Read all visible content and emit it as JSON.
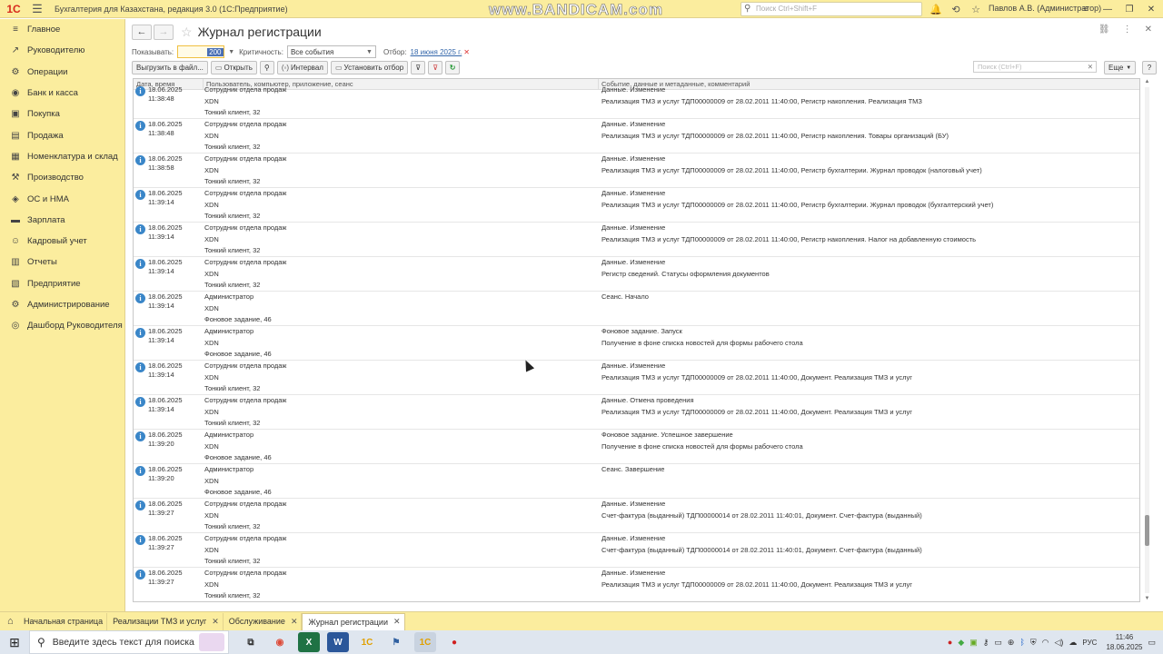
{
  "titlebar": {
    "logo": "1С",
    "app_title": "Бухгалтерия для Казахстана, редакция 3.0 (1С:Предприятие)",
    "watermark": "www.BANDICAM.com",
    "search_placeholder": "Поиск Ctrl+Shift+F",
    "user": "Павлов А.В. (Администратор)"
  },
  "sidebar": {
    "items": [
      {
        "label": "Главное",
        "icon": "menu-icon"
      },
      {
        "label": "Руководителю",
        "icon": "chart-line-icon"
      },
      {
        "label": "Операции",
        "icon": "operations-icon"
      },
      {
        "label": "Банк и касса",
        "icon": "bank-icon"
      },
      {
        "label": "Покупка",
        "icon": "cart-icon"
      },
      {
        "label": "Продажа",
        "icon": "sale-icon"
      },
      {
        "label": "Номенклатура и склад",
        "icon": "warehouse-icon"
      },
      {
        "label": "Производство",
        "icon": "production-icon"
      },
      {
        "label": "ОС и НМА",
        "icon": "assets-icon"
      },
      {
        "label": "Зарплата",
        "icon": "salary-icon"
      },
      {
        "label": "Кадровый учет",
        "icon": "hr-icon"
      },
      {
        "label": "Отчеты",
        "icon": "reports-icon"
      },
      {
        "label": "Предприятие",
        "icon": "enterprise-icon"
      },
      {
        "label": "Администрирование",
        "icon": "admin-icon"
      },
      {
        "label": "Дашборд Руководителя",
        "icon": "dashboard-icon"
      }
    ]
  },
  "form": {
    "title": "Журнал регистрации",
    "filters": {
      "show_label": "Показывать:",
      "show_value": "200",
      "criticality_label": "Критичность:",
      "criticality_value": "Все события",
      "otbor_label": "Отбор:",
      "otbor_value": "18 июня 2025 г."
    },
    "toolbar": {
      "export": "Выгрузить в файл...",
      "open": "Открыть",
      "interval": "Интервал",
      "set_filter": "Установить отбор",
      "search_placeholder": "Поиск (Ctrl+F)",
      "more": "Еще",
      "help": "?"
    },
    "columns": {
      "date": "Дата, время",
      "user": "Пользователь, компьютер, приложение, сеанс",
      "event": "Событие, данные и метаданные, комментарий"
    },
    "rows": [
      {
        "date": "18.06.2025",
        "time": "11:38:48",
        "user": "Сотрудник отдела продаж",
        "computer": "XDN",
        "app": "Тонкий клиент, 32",
        "event": "Данные. Изменение",
        "data": "Реализация ТМЗ и услуг ТДП00000009 от 28.02.2011 11:40:00, Регистр накопления. Реализация ТМЗ"
      },
      {
        "date": "18.06.2025",
        "time": "11:38:48",
        "user": "Сотрудник отдела продаж",
        "computer": "XDN",
        "app": "Тонкий клиент, 32",
        "event": "Данные. Изменение",
        "data": "Реализация ТМЗ и услуг ТДП00000009 от 28.02.2011 11:40:00, Регистр накопления. Товары организаций (БУ)"
      },
      {
        "date": "18.06.2025",
        "time": "11:38:58",
        "user": "Сотрудник отдела продаж",
        "computer": "XDN",
        "app": "Тонкий клиент, 32",
        "event": "Данные. Изменение",
        "data": "Реализация ТМЗ и услуг ТДП00000009 от 28.02.2011 11:40:00, Регистр бухгалтерии. Журнал проводок (налоговый учет)"
      },
      {
        "date": "18.06.2025",
        "time": "11:39:14",
        "user": "Сотрудник отдела продаж",
        "computer": "XDN",
        "app": "Тонкий клиент, 32",
        "event": "Данные. Изменение",
        "data": "Реализация ТМЗ и услуг ТДП00000009 от 28.02.2011 11:40:00, Регистр бухгалтерии. Журнал проводок (бухгалтерский учет)"
      },
      {
        "date": "18.06.2025",
        "time": "11:39:14",
        "user": "Сотрудник отдела продаж",
        "computer": "XDN",
        "app": "Тонкий клиент, 32",
        "event": "Данные. Изменение",
        "data": "Реализация ТМЗ и услуг ТДП00000009 от 28.02.2011 11:40:00, Регистр накопления. Налог на добавленную стоимость"
      },
      {
        "date": "18.06.2025",
        "time": "11:39:14",
        "user": "Сотрудник отдела продаж",
        "computer": "XDN",
        "app": "Тонкий клиент, 32",
        "event": "Данные. Изменение",
        "data": "Регистр сведений. Статусы оформления документов"
      },
      {
        "date": "18.06.2025",
        "time": "11:39:14",
        "user": "Администратор",
        "computer": "XDN",
        "app": "Фоновое задание, 46",
        "event": "Сеанс. Начало",
        "data": ""
      },
      {
        "date": "18.06.2025",
        "time": "11:39:14",
        "user": "Администратор",
        "computer": "XDN",
        "app": "Фоновое задание, 46",
        "event": "Фоновое задание. Запуск",
        "data": "Получение в фоне списка новостей для формы рабочего стола"
      },
      {
        "date": "18.06.2025",
        "time": "11:39:14",
        "user": "Сотрудник отдела продаж",
        "computer": "XDN",
        "app": "Тонкий клиент, 32",
        "event": "Данные. Изменение",
        "data": "Реализация ТМЗ и услуг ТДП00000009 от 28.02.2011 11:40:00, Документ. Реализация ТМЗ и услуг"
      },
      {
        "date": "18.06.2025",
        "time": "11:39:14",
        "user": "Сотрудник отдела продаж",
        "computer": "XDN",
        "app": "Тонкий клиент, 32",
        "event": "Данные. Отмена проведения",
        "data": "Реализация ТМЗ и услуг ТДП00000009 от 28.02.2011 11:40:00, Документ. Реализация ТМЗ и услуг"
      },
      {
        "date": "18.06.2025",
        "time": "11:39:20",
        "user": "Администратор",
        "computer": "XDN",
        "app": "Фоновое задание, 46",
        "event": "Фоновое задание. Успешное завершение",
        "data": "Получение в фоне списка новостей для формы рабочего стола"
      },
      {
        "date": "18.06.2025",
        "time": "11:39:20",
        "user": "Администратор",
        "computer": "XDN",
        "app": "Фоновое задание, 46",
        "event": "Сеанс. Завершение",
        "data": ""
      },
      {
        "date": "18.06.2025",
        "time": "11:39:27",
        "user": "Сотрудник отдела продаж",
        "computer": "XDN",
        "app": "Тонкий клиент, 32",
        "event": "Данные. Изменение",
        "data": "Счет-фактура (выданный) ТДП00000014 от 28.02.2011 11:40:01, Документ. Счет-фактура (выданный)"
      },
      {
        "date": "18.06.2025",
        "time": "11:39:27",
        "user": "Сотрудник отдела продаж",
        "computer": "XDN",
        "app": "Тонкий клиент, 32",
        "event": "Данные. Изменение",
        "data": "Счет-фактура (выданный) ТДП00000014 от 28.02.2011 11:40:01, Документ. Счет-фактура (выданный)"
      },
      {
        "date": "18.06.2025",
        "time": "11:39:27",
        "user": "Сотрудник отдела продаж",
        "computer": "XDN",
        "app": "Тонкий клиент, 32",
        "event": "Данные. Изменение",
        "data": "Реализация ТМЗ и услуг ТДП00000009 от 28.02.2011 11:40:00, Документ. Реализация ТМЗ и услуг"
      }
    ],
    "scroll_position": 0.9
  },
  "open_tabs": {
    "items": [
      {
        "label": "Начальная страница",
        "closable": false
      },
      {
        "label": "Реализации ТМЗ и услуг",
        "closable": true
      },
      {
        "label": "Обслуживание",
        "closable": true
      },
      {
        "label": "Журнал регистрации",
        "closable": true,
        "active": true
      }
    ]
  },
  "taskbar": {
    "search_placeholder": "Введите здесь текст для поиска",
    "lang": "РУС",
    "time": "11:46",
    "date": "18.06.2025"
  },
  "colors": {
    "shell_yellow": "#fbed9e",
    "info_icon": "#3a86c8",
    "link": "#3366aa"
  }
}
